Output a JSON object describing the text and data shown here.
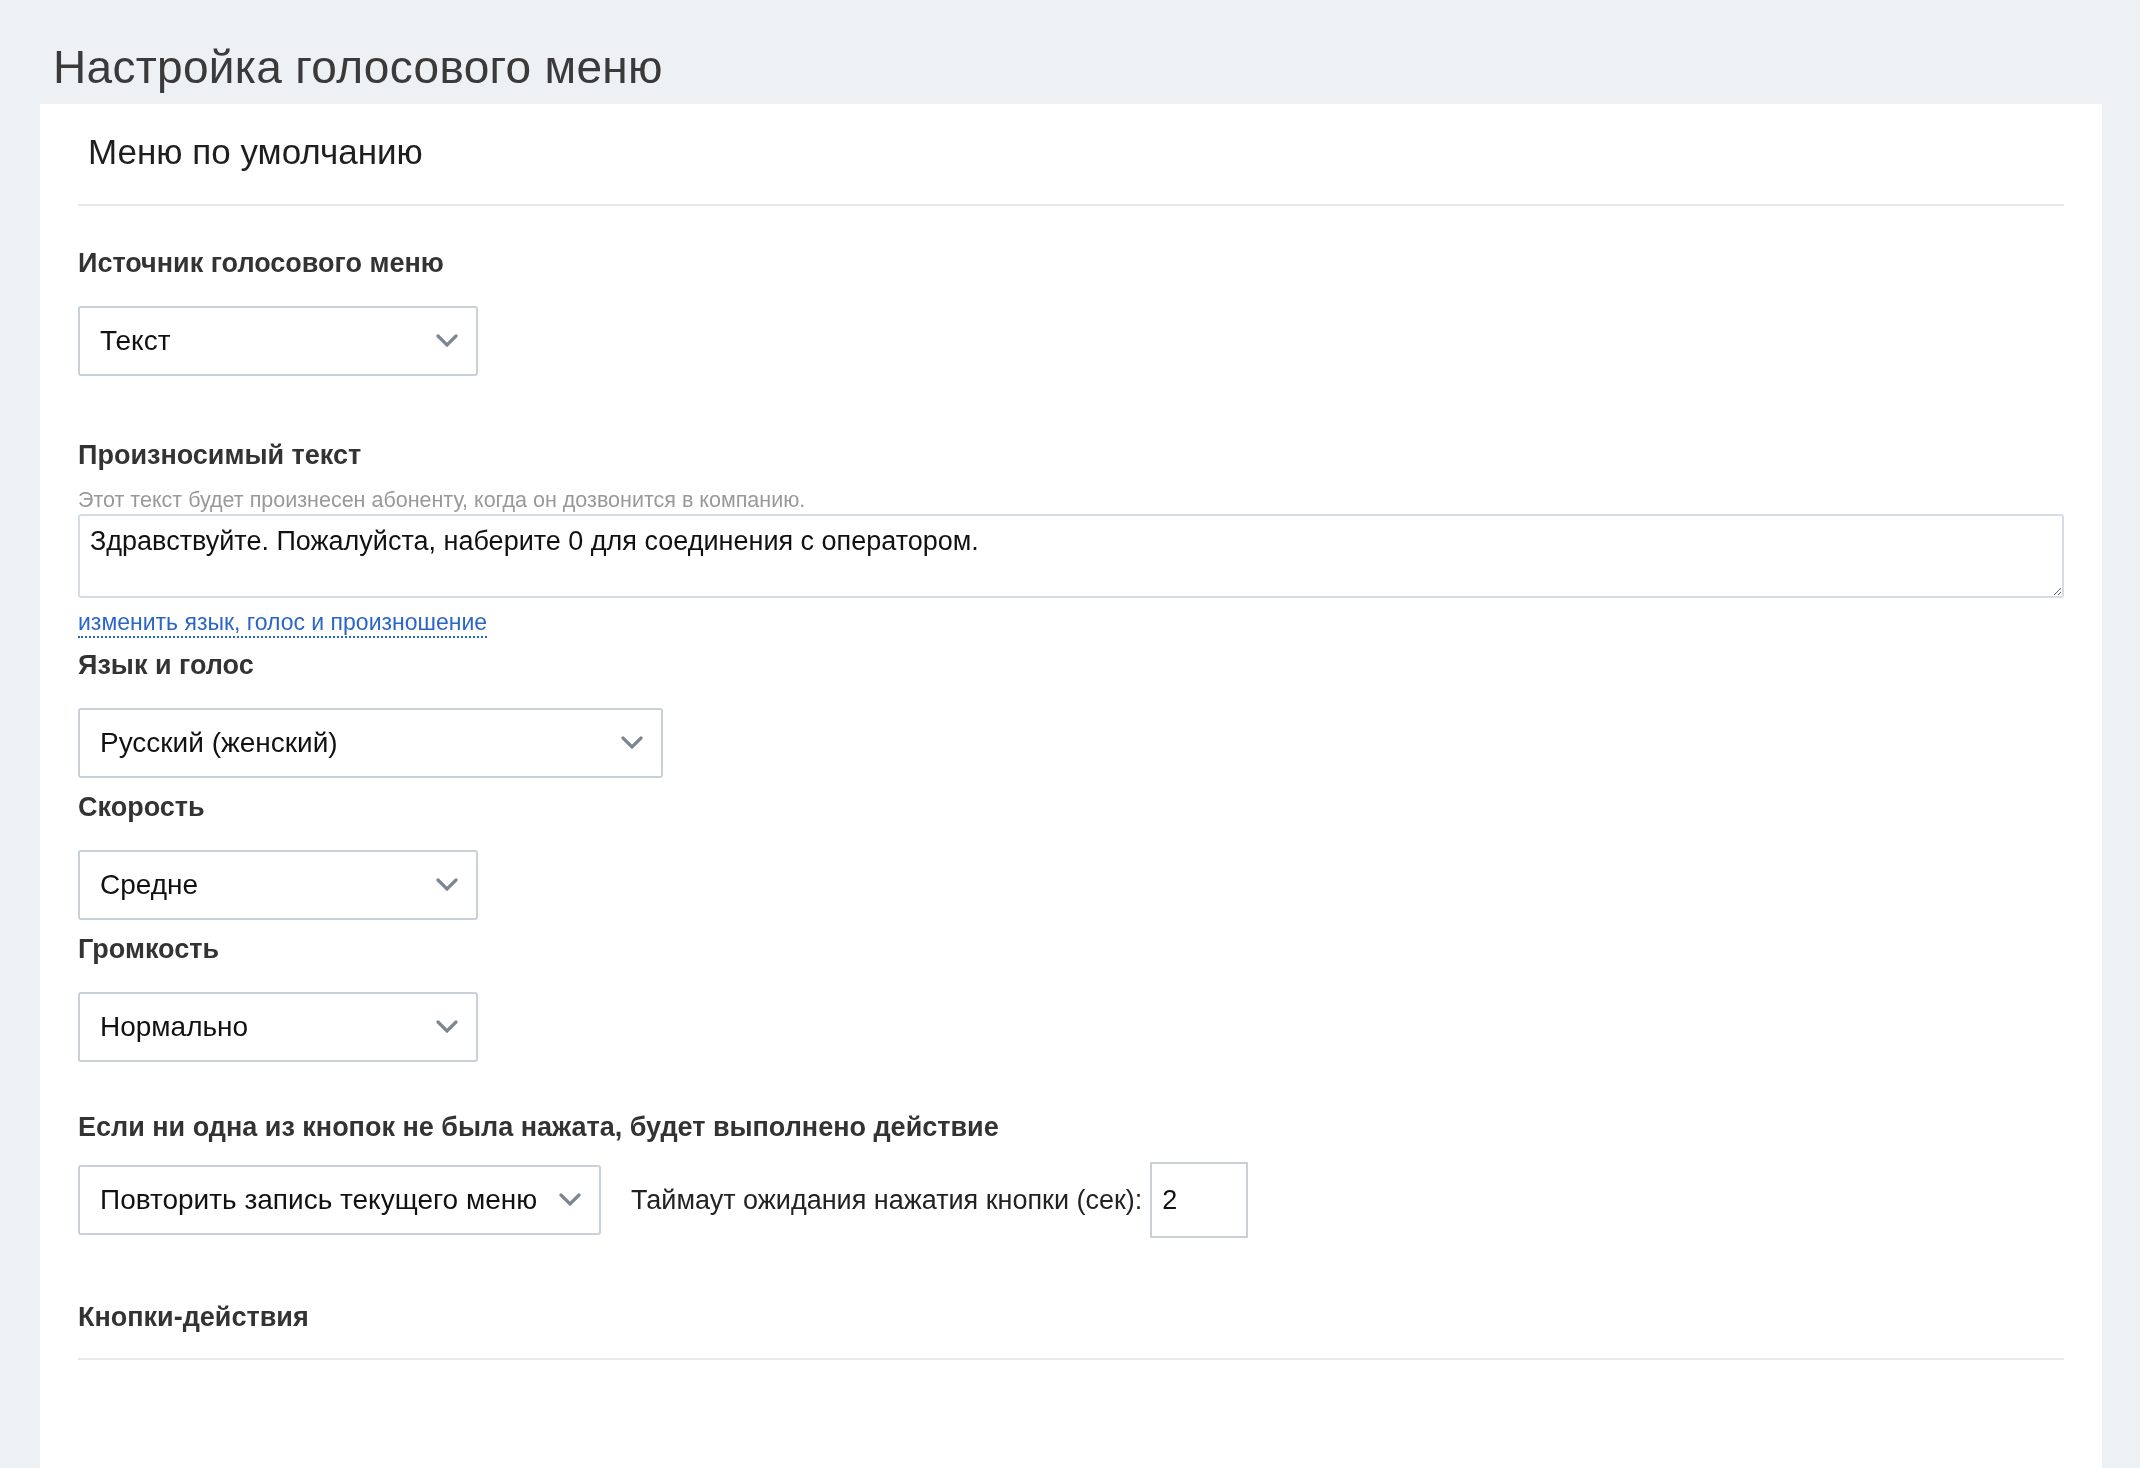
{
  "page_title": "Настройка голосового меню",
  "card": {
    "title": "Меню по умолчанию",
    "fields": [
      {
        "kind": "select",
        "label": "Источник голосового меню",
        "value": "Текст"
      },
      {
        "kind": "textarea",
        "label": "Произносимый текст",
        "hint": "Этот текст будет произнесен абоненту, когда он дозвонится в компанию.",
        "value": "Здравствуйте. Пожалуйста, наберите 0 для соединения с оператором.",
        "link": "изменить язык, голос и произношение"
      },
      {
        "kind": "select",
        "label": "Язык и голос",
        "value": "Русский (женский)"
      },
      {
        "kind": "select",
        "label": "Скорость",
        "value": "Средне"
      },
      {
        "kind": "select",
        "label": "Громкость",
        "value": "Нормально"
      },
      {
        "kind": "action",
        "label": "Если ни одна из кнопок не была нажата, будет выполнено действие",
        "value": "Повторить запись текущего меню",
        "timeout_label": "Таймаут ожидания нажатия кнопки (сек):",
        "timeout_value": "2"
      },
      {
        "kind": "heading",
        "label": "Кнопки-действия"
      }
    ]
  }
}
